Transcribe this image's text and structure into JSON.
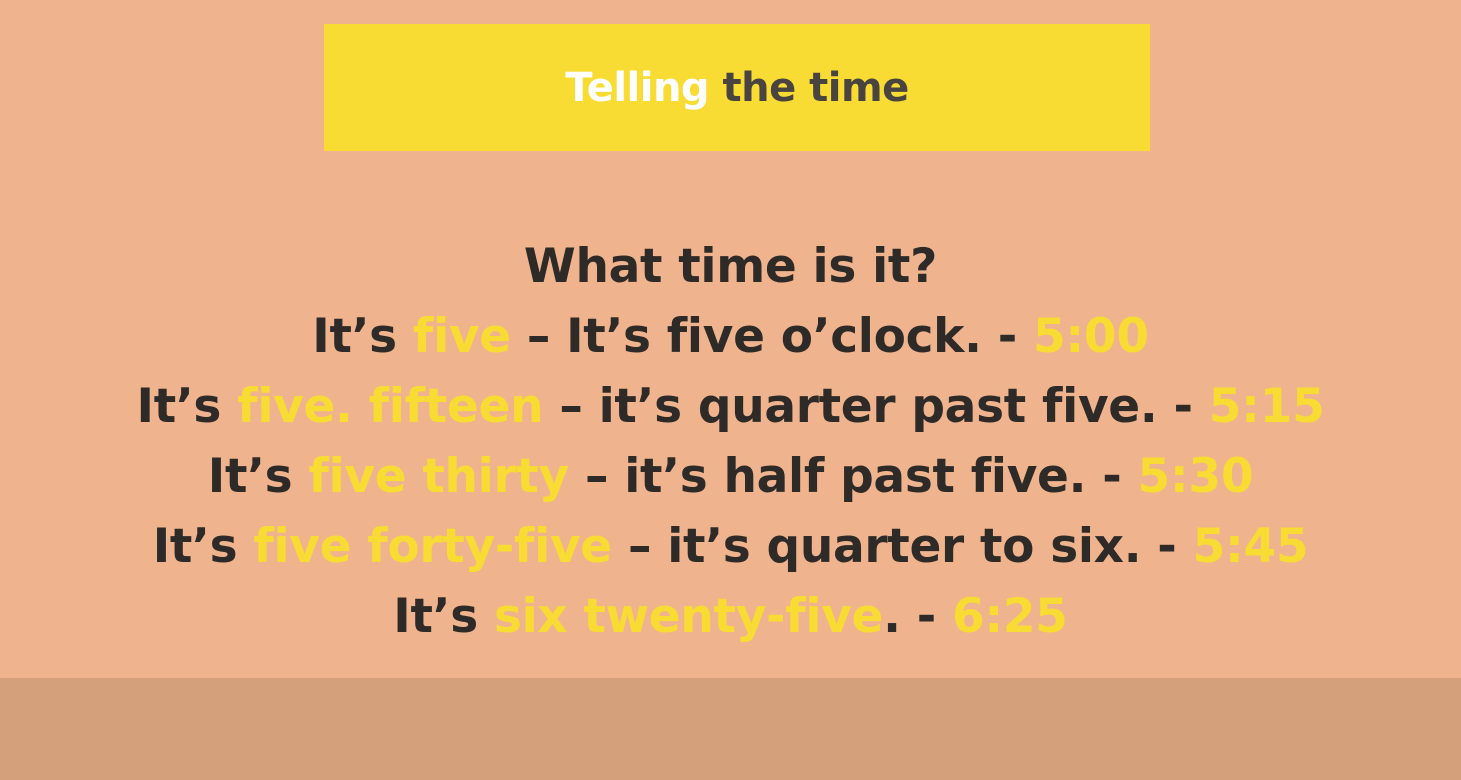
{
  "title": {
    "part1": "Telling",
    "part2": " the time"
  },
  "question": "What time is it?",
  "lines": [
    {
      "prefix": "It’s ",
      "highlight": "five",
      "rest": " – It’s five o’clock.  - ",
      "time": "5:00"
    },
    {
      "prefix": "It’s ",
      "highlight": "five. fifteen",
      "rest": " – it’s quarter past five. - ",
      "time": "5:15"
    },
    {
      "prefix": "It’s ",
      "highlight": "five thirty",
      "rest": " – it’s half past five. - ",
      "time": "5:30"
    },
    {
      "prefix": "It’s ",
      "highlight": "five forty-five",
      "rest": " – it’s quarter to six. - ",
      "time": "5:45"
    },
    {
      "prefix": "It’s ",
      "highlight": "six twenty-five",
      "rest": ". - ",
      "time": "6:25"
    }
  ],
  "colors": {
    "background": "#efb48e",
    "footer": "#d4a07c",
    "title_box": "#f8db33",
    "highlight": "#f8db33",
    "text_dark": "#2e2a28"
  }
}
